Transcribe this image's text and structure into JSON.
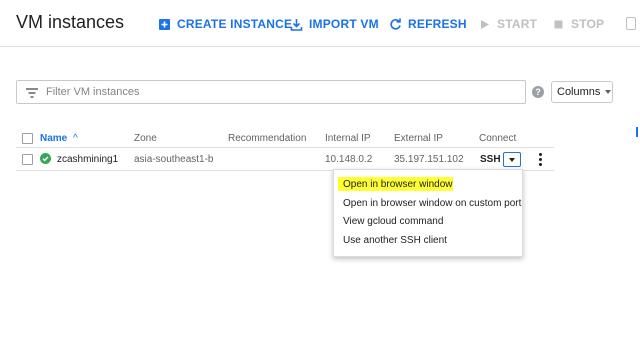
{
  "header": {
    "title": "VM instances",
    "actions": [
      {
        "label": "CREATE INSTANCE",
        "icon": "add-box-icon",
        "enabled": true
      },
      {
        "label": "IMPORT VM",
        "icon": "import-icon",
        "enabled": true
      },
      {
        "label": "REFRESH",
        "icon": "refresh-icon",
        "enabled": true
      },
      {
        "label": "START",
        "icon": "play-icon",
        "enabled": false
      },
      {
        "label": "STOP",
        "icon": "stop-icon",
        "enabled": false
      }
    ]
  },
  "filter": {
    "placeholder": "Filter VM instances",
    "icon": "filter-list-icon"
  },
  "help": {
    "glyph": "?"
  },
  "columns_button": {
    "label": "Columns"
  },
  "table": {
    "headers": [
      "Name",
      "Zone",
      "Recommendation",
      "Internal IP",
      "External IP",
      "Connect"
    ],
    "sort_indicator": "^",
    "rows": [
      {
        "status": "running",
        "name": "zcashmining1",
        "zone": "asia-southeast1-b",
        "recommendation": "",
        "internal_ip": "10.148.0.2",
        "external_ip": "35.197.151.102",
        "connect": "SSH"
      }
    ]
  },
  "ssh_menu": {
    "items": [
      "Open in browser window",
      "Open in browser window on custom port",
      "View gcloud command",
      "Use another SSH client"
    ],
    "highlighted_index": 0,
    "highlight_color": "#ffff33"
  },
  "colors": {
    "accent": "#1a73e8",
    "running": "#34a853",
    "disabled": "#c0c0c0"
  }
}
